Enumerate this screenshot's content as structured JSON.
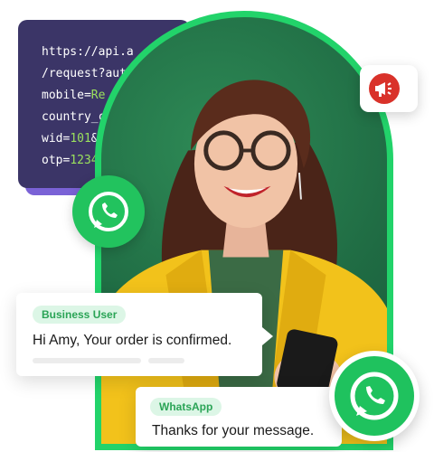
{
  "code_card": {
    "lines": [
      {
        "text": "https://api.a"
      },
      {
        "text": "/request?aut"
      },
      {
        "text": "mobile=",
        "hl": "Re"
      },
      {
        "text": "country_c"
      },
      {
        "text": "wid=",
        "hl": "101",
        "tail": "&r"
      },
      {
        "text": "otp=",
        "hl": "1234"
      }
    ]
  },
  "badges": {
    "megaphone": "megaphone-icon",
    "whatsapp_small": "whatsapp-icon",
    "whatsapp_large": "whatsapp-icon"
  },
  "message_business": {
    "tag": "Business User",
    "text": "Hi Amy, Your order is confirmed."
  },
  "message_whatsapp": {
    "tag": "WhatsApp",
    "text": "Thanks for your message."
  },
  "colors": {
    "accent_green": "#22d36a",
    "code_bg": "#3b3567",
    "code_shadow": "#7a62d6",
    "alert_red": "#d9322a",
    "tag_bg": "#dcf6e6"
  }
}
